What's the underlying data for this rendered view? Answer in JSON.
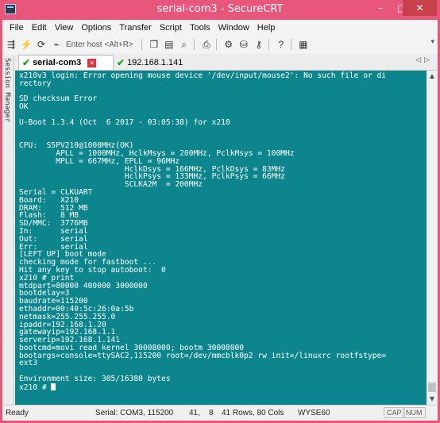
{
  "window": {
    "title": "serial-com3 - SecureCRT",
    "minimize": "–",
    "maximize": "□",
    "close": "✕"
  },
  "menu": [
    "File",
    "Edit",
    "View",
    "Options",
    "Transfer",
    "Script",
    "Tools",
    "Window",
    "Help"
  ],
  "toolbar": {
    "host_placeholder": "Enter host <Alt+R>",
    "icons": [
      "connect-icon",
      "lightning-icon",
      "reconnect-icon",
      "disconnect-icon",
      "copy-icon",
      "paste-icon",
      "find-icon",
      "print-icon",
      "settings-icon",
      "sftp-icon",
      "key-icon",
      "help-icon",
      "keymap-icon"
    ]
  },
  "session_manager": {
    "label": "Session Manager"
  },
  "tabs": [
    {
      "label": "serial-com3",
      "status": "connected",
      "active": true
    },
    {
      "label": "192.168.1.141",
      "status": "connected",
      "active": false
    }
  ],
  "terminal": {
    "colors": {
      "background": "#0d858d",
      "foreground": "#ffffff"
    },
    "lines": [
      "x210v3 login: Error opening mouse device '/dev/input/mouse2': No such file or di",
      "rectory",
      "",
      "SD checksum Error",
      "OK",
      "",
      "U-Boot 1.3.4 (Oct  6 2017 - 03:05:38) for x210",
      "",
      "",
      "CPU:  S5PV210@1000MHz(OK)",
      "        APLL = 1000MHz, HclkMsys = 200MHz, PclkMsys = 100MHz",
      "        MPLL = 667MHz, EPLL = 96MHz",
      "                       HclkDsys = 166MHz, PclkDsys = 83MHz",
      "                       HclkPsys = 133MHz, PclkPsys = 66MHz",
      "                       SCLKA2M  = 200MHz",
      "Serial = CLKUART",
      "Board:   X210",
      "DRAM:    512 MB",
      "Flash:   8 MB",
      "SD/MMC:  3776MB",
      "In:      serial",
      "Out:     serial",
      "Err:     serial",
      "[LEFT UP] boot mode",
      "checking mode for fastboot ...",
      "Hit any key to stop autoboot:  0",
      "x210 # print",
      "mtdpart=80000 400000 3000000",
      "bootdelay=3",
      "baudrate=115200",
      "ethaddr=00:40:5c:26:0a:5b",
      "netmask=255.255.255.0",
      "ipaddr=192.168.1.20",
      "gatewayip=192.168.1.1",
      "serverip=192.168.1.141",
      "bootcmd=movi read kernel 30008000; bootm 30008000",
      "bootargs=console=ttySAC2,115200 root=/dev/mmcblk0p2 rw init=/linuxrc rootfstype=",
      "ext3",
      "",
      "Environment size: 305/16380 bytes"
    ],
    "prompt": "x210 # "
  },
  "status": {
    "ready": "Ready",
    "serial": "Serial: COM3, 115200",
    "row": "41,",
    "col": "8",
    "size": "41 Rows, 80 Cols",
    "emulation": "WYSE60",
    "caps": "CAP",
    "num": "NUM"
  }
}
